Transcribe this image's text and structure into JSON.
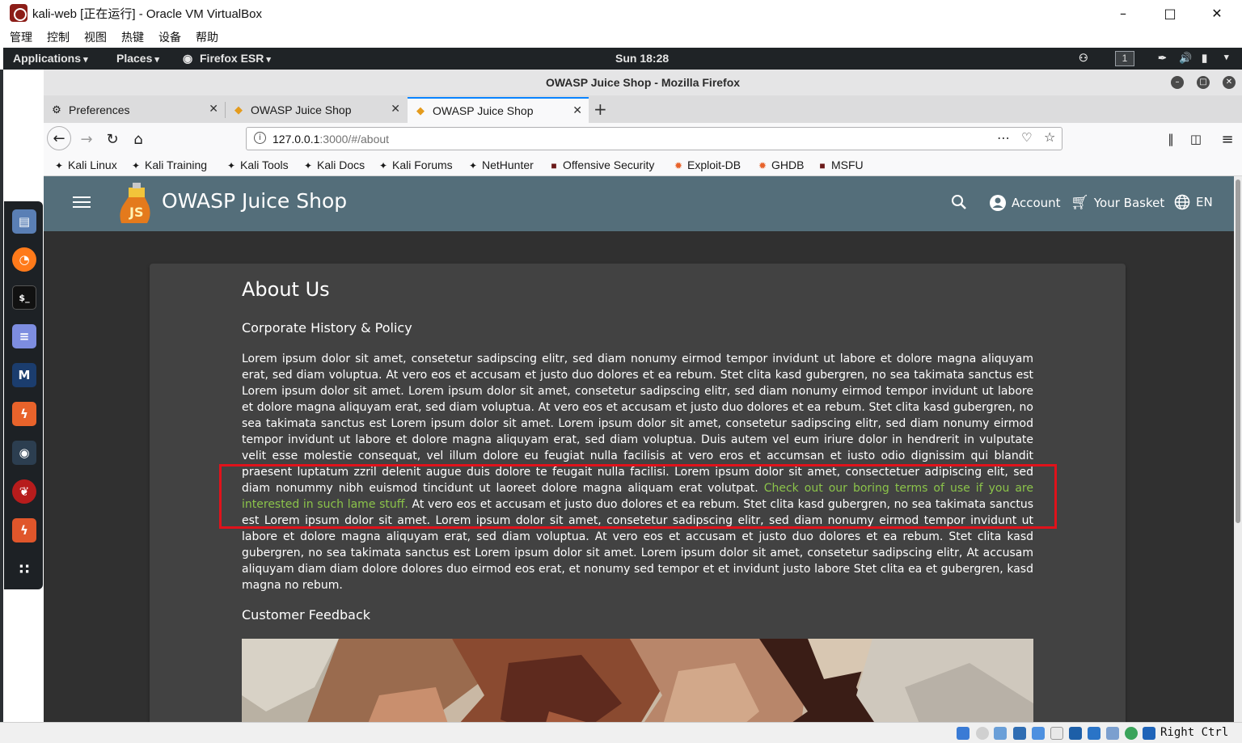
{
  "vbox": {
    "window_title": "kali-web [正在运行] - Oracle VM VirtualBox",
    "menu": [
      "管理",
      "控制",
      "视图",
      "热键",
      "设备",
      "帮助"
    ],
    "host_key": "Right Ctrl"
  },
  "kali_panel": {
    "applications": "Applications",
    "places": "Places",
    "active_app": "Firefox ESR",
    "clock": "Sun 18:28",
    "workspace": "1"
  },
  "firefox": {
    "window_title": "OWASP Juice Shop - Mozilla Firefox",
    "tabs": [
      {
        "label": "Preferences",
        "active": false
      },
      {
        "label": "OWASP Juice Shop",
        "active": false
      },
      {
        "label": "OWASP Juice Shop",
        "active": true
      }
    ],
    "url_host": "127.0.0.1",
    "url_rest": ":3000/#/about",
    "bookmarks": [
      "Kali Linux",
      "Kali Training",
      "Kali Tools",
      "Kali Docs",
      "Kali Forums",
      "NetHunter",
      "Offensive Security",
      "Exploit-DB",
      "GHDB",
      "MSFU"
    ]
  },
  "app": {
    "brand": "OWASP Juice Shop",
    "account": "Account",
    "basket": "Your Basket",
    "language": "EN",
    "colors": {
      "toolbar": "#546e7a",
      "background": "#303030",
      "card": "#424242",
      "link": "#8bc34a",
      "highlight": "#e0121b"
    }
  },
  "about": {
    "title": "About Us",
    "subtitle": "Corporate History & Policy",
    "para_1": "Lorem ipsum dolor sit amet, consetetur sadipscing elitr, sed diam nonumy eirmod tempor invidunt ut labore et dolore magna aliquyam erat, sed diam voluptua. At vero eos et accusam et justo duo dolores et ea rebum. Stet clita kasd gubergren, no sea takimata sanctus est Lorem ipsum dolor sit amet. Lorem ipsum dolor sit amet, consetetur sadipscing elitr, sed diam nonumy eirmod tempor invidunt ut labore et dolore magna aliquyam erat, sed diam voluptua. At vero eos et accusam et justo duo dolores et ea rebum. Stet clita kasd gubergren, no sea takimata sanctus est Lorem ipsum dolor sit amet. Lorem ipsum dolor sit amet, consetetur sadipscing elitr, sed diam nonumy eirmod tempor invidunt ut labore et dolore magna aliquyam erat, sed diam voluptua. Duis autem vel eum iriure dolor in hendrerit in vulputate velit esse molestie consequat, vel illum dolore eu feugiat nulla facilisis at vero eros et accumsan et iusto odio dignissim qui blandit praesent luptatum zzril delenit augue duis dolore te feugait nulla facilisi. Lorem ipsum dolor sit amet, consectetuer adipiscing elit, sed diam nonummy nibh euismod tincidunt ut laoreet dolore magna aliquam erat volutpat. ",
    "terms_link": "Check out our boring terms of use if you are interested in such lame stuff.",
    "para_2": " At vero eos et accusam et justo duo dolores et ea rebum. Stet clita kasd gubergren, no sea takimata sanctus est Lorem ipsum dolor sit amet. Lorem ipsum dolor sit amet, consetetur sadipscing elitr, sed diam nonumy eirmod tempor invidunt ut labore et dolore magna aliquyam erat, sed diam voluptua. At vero eos et accusam et justo duo dolores et ea rebum. Stet clita kasd gubergren, no sea takimata sanctus est Lorem ipsum dolor sit amet. Lorem ipsum dolor sit amet, consetetur sadipscing elitr, At accusam aliquyam diam diam dolore dolores duo eirmod eos erat, et nonumy sed tempor et et invidunt justo labore Stet clita ea et gubergren, kasd magna no rebum.",
    "feedback_title": "Customer Feedback"
  }
}
